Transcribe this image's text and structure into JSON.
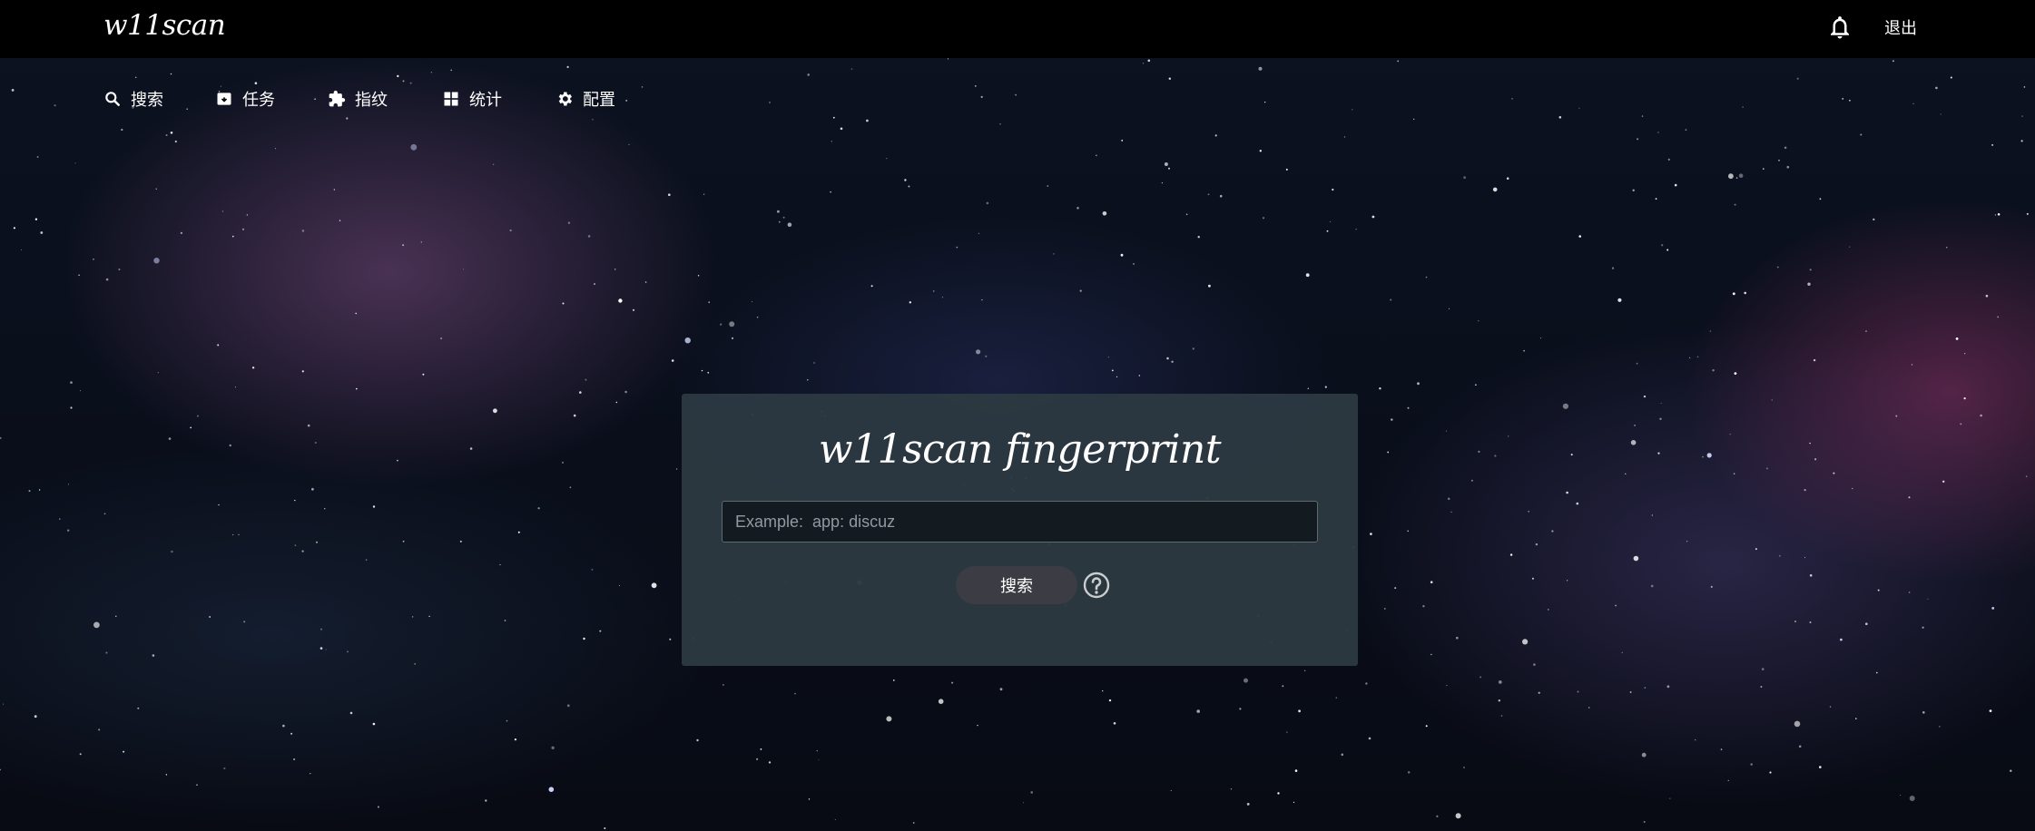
{
  "app": {
    "logo": "w11scan"
  },
  "header": {
    "logout_label": "退出",
    "bell_icon": "bell-icon"
  },
  "nav": {
    "items": [
      {
        "label": "搜索",
        "icon": "search-icon"
      },
      {
        "label": "任务",
        "icon": "inbox-icon"
      },
      {
        "label": "指纹",
        "icon": "puzzle-icon"
      },
      {
        "label": "统计",
        "icon": "dashboard-icon"
      },
      {
        "label": "配置",
        "icon": "gear-icon"
      }
    ]
  },
  "search": {
    "title": "w11scan fingerprint",
    "placeholder": "Example:  app: discuz",
    "value": "",
    "button_label": "搜索",
    "help_icon": "help-icon"
  },
  "colors": {
    "topbar": "#000000",
    "card": "#2c3941",
    "input_bg": "#141b20",
    "button": "#3c3d44"
  }
}
